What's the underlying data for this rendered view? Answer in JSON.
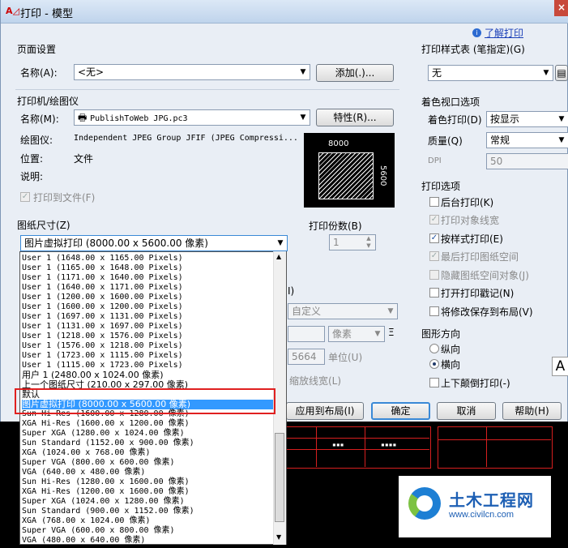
{
  "window": {
    "title": "打印 - 模型",
    "close": "×",
    "help_link": "了解打印"
  },
  "page_setup": {
    "label": "页面设置",
    "name_label": "名称(A):",
    "name_value": "<无>",
    "add_button": "添加(.)..."
  },
  "printer": {
    "label": "打印机/绘图仪",
    "name_label": "名称(M):",
    "name_value": "PublishToWeb JPG.pc3",
    "properties_button": "特性(R)...",
    "plotter_label": "绘图仪:",
    "plotter_value": "Independent JPEG Group JFIF (JPEG Compressi...",
    "location_label": "位置:",
    "location_value": "文件",
    "description_label": "说明:",
    "print_to_file": "打印到文件(F)",
    "preview_width": "8000",
    "preview_height": "5600"
  },
  "paper_size": {
    "label": "图纸尺寸(Z)",
    "selected": "图片虚拟打印 (8000.00 x 5600.00 像素)",
    "options": [
      "User 1 (1648.00 x 1165.00 Pixels)",
      "User 1 (1165.00 x 1648.00 Pixels)",
      "User 1 (1171.00 x 1640.00 Pixels)",
      "User 1 (1640.00 x 1171.00 Pixels)",
      "User 1 (1200.00 x 1600.00 Pixels)",
      "User 1 (1600.00 x 1200.00 Pixels)",
      "User 1 (1697.00 x 1131.00 Pixels)",
      "User 1 (1131.00 x 1697.00 Pixels)",
      "User 1 (1218.00 x 1576.00 Pixels)",
      "User 1 (1576.00 x 1218.00 Pixels)",
      "User 1 (1723.00 x 1115.00 Pixels)",
      "User 1 (1115.00 x 1723.00 Pixels)",
      "用户 1 (2480.00 x 1024.00 像素)",
      "上一个图纸尺寸 (210.00 x 297.00 像素)",
      "默认",
      "图片虚拟打印 (8000.00 x 5600.00 像素)",
      "Sun Hi-Res (1600.00 x 1280.00 像素)",
      "XGA Hi-Res (1600.00 x 1200.00 像素)",
      "Super XGA (1280.00 x 1024.00 像素)",
      "Sun Standard (1152.00 x 900.00 像素)",
      "XGA (1024.00 x 768.00 像素)",
      "Super VGA (800.00 x 600.00 像素)",
      "VGA (640.00 x 480.00 像素)",
      "Sun Hi-Res (1280.00 x 1600.00 像素)",
      "XGA Hi-Res (1200.00 x 1600.00 像素)",
      "Super XGA (1024.00 x 1280.00 像素)",
      "Sun Standard (900.00 x 1152.00 像素)",
      "XGA (768.00 x 1024.00 像素)",
      "Super VGA (600.00 x 800.00 像素)",
      "VGA (480.00 x 640.00 像素)"
    ],
    "selected_index": 15
  },
  "copies": {
    "label": "打印份数(B)",
    "value": "1"
  },
  "hidden_fields": {
    "custom_value": "自定义",
    "units_value": "像素",
    "equals": "Ξ",
    "height_value": "5664",
    "units_label": "单位(U)",
    "scale_lineweights": "缩放线宽(L)",
    "paren_hint": "I)"
  },
  "plot_style": {
    "label": "打印样式表 (笔指定)(G)",
    "value": "无",
    "edit_icon": "edit-icon"
  },
  "shaded": {
    "label": "着色视口选项",
    "shade_label": "着色打印(D)",
    "shade_value": "按显示",
    "quality_label": "质量(Q)",
    "quality_value": "常规",
    "dpi_label": "DPI",
    "dpi_value": "50"
  },
  "plot_options": {
    "label": "打印选项",
    "items": [
      {
        "label": "后台打印(K)",
        "checked": false,
        "disabled": false
      },
      {
        "label": "打印对象线宽",
        "checked": true,
        "disabled": true
      },
      {
        "label": "按样式打印(E)",
        "checked": true,
        "disabled": false
      },
      {
        "label": "最后打印图纸空间",
        "checked": true,
        "disabled": true
      },
      {
        "label": "隐藏图纸空间对象(J)",
        "checked": false,
        "disabled": true
      },
      {
        "label": "打开打印戳记(N)",
        "checked": false,
        "disabled": false
      },
      {
        "label": "将修改保存到布局(V)",
        "checked": false,
        "disabled": false
      }
    ]
  },
  "orientation": {
    "label": "图形方向",
    "portrait": "纵向",
    "landscape": "横向",
    "upside_down": "上下颠倒打印(-)",
    "icon_letter": "A"
  },
  "buttons": {
    "apply": "应用到布局(I)",
    "ok": "确定",
    "cancel": "取消",
    "help": "帮助(H)"
  },
  "watermark": {
    "title": "土木工程网",
    "url": "www.civilcn.com"
  },
  "colors": {
    "highlight": "#e02020",
    "selection": "#3399ff",
    "cad_red": "#d61f1f"
  }
}
